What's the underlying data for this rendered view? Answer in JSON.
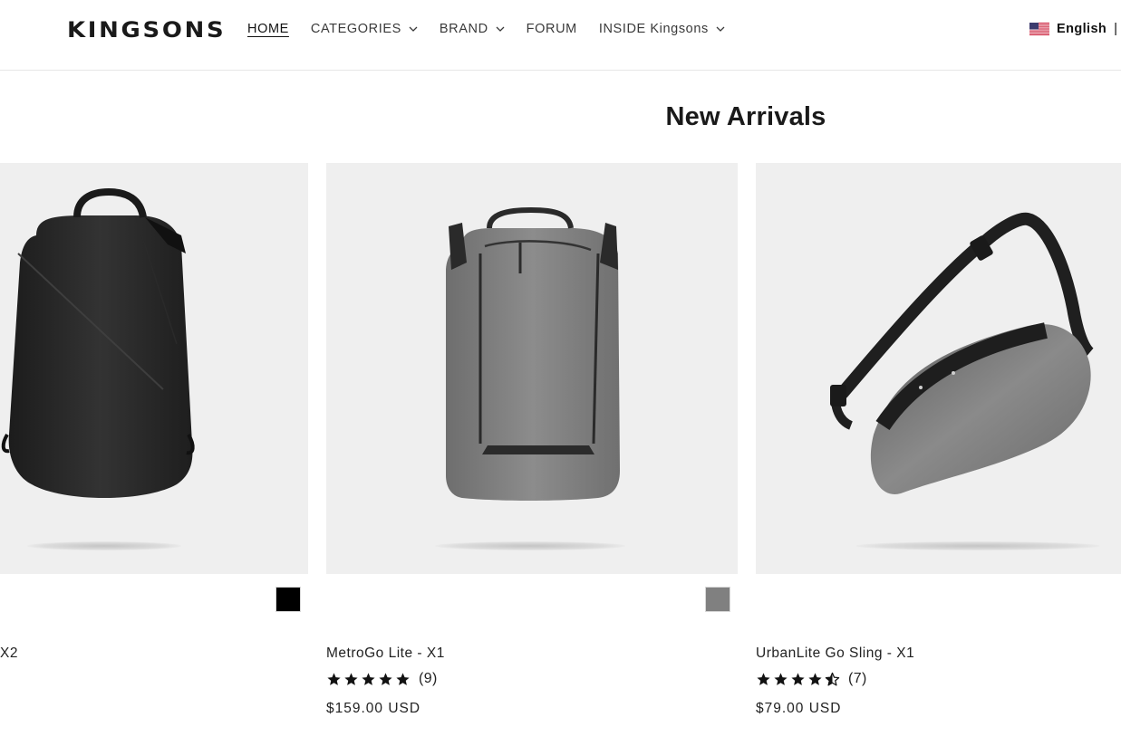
{
  "header": {
    "logo": "KINGSONS",
    "nav": [
      {
        "label": "HOME",
        "active": true,
        "dropdown": false
      },
      {
        "label": "CATEGORIES",
        "active": false,
        "dropdown": true
      },
      {
        "label": "BRAND",
        "active": false,
        "dropdown": true
      },
      {
        "label": "FORUM",
        "active": false,
        "dropdown": false
      },
      {
        "label": "INSIDE Kingsons",
        "active": false,
        "dropdown": true
      }
    ],
    "language": {
      "label": "English",
      "separator": "|",
      "flag_icon": "us-flag-icon"
    }
  },
  "section": {
    "title": "New Arrivals"
  },
  "products": [
    {
      "title": "X2",
      "swatch_color": "#000000",
      "bag_color": "#2b2b2b"
    },
    {
      "title": "MetroGo Lite - X1",
      "rating_stars": 5,
      "review_count": "(9)",
      "price": "$159.00 USD",
      "swatch_color": "#808080",
      "bag_color": "#7a7a7a"
    },
    {
      "title": "UrbanLite Go Sling - X1",
      "rating_stars": 4.5,
      "review_count": "(7)",
      "price": "$79.00 USD",
      "bag_color": "#6e6e6e"
    }
  ],
  "colors": {
    "accent": "#121212",
    "card_bg": "#efefef",
    "divider": "#e6e6e6"
  }
}
